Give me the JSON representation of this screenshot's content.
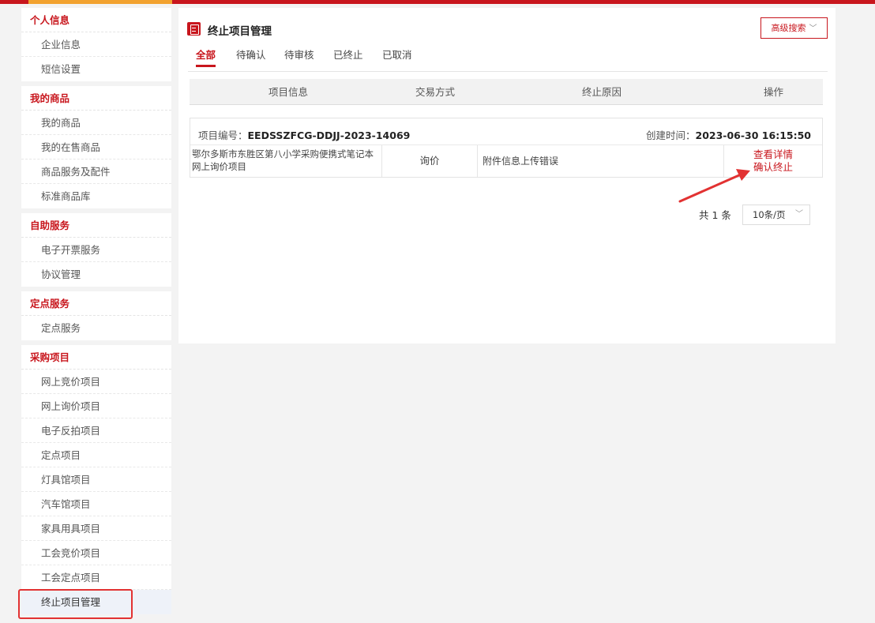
{
  "sidebar": {
    "groups": [
      {
        "title": "个人信息",
        "items": [
          "企业信息",
          "短信设置"
        ]
      },
      {
        "title": "我的商品",
        "items": [
          "我的商品",
          "我的在售商品",
          "商品服务及配件",
          "标准商品库"
        ]
      },
      {
        "title": "自助服务",
        "items": [
          "电子开票服务",
          "协议管理"
        ]
      },
      {
        "title": "定点服务",
        "items": [
          "定点服务"
        ]
      },
      {
        "title": "采购项目",
        "items": [
          "网上竞价项目",
          "网上询价项目",
          "电子反拍项目",
          "定点项目",
          "灯具馆项目",
          "汽车馆项目",
          "家具用具项目",
          "工会竞价项目",
          "工会定点项目",
          "终止项目管理"
        ]
      }
    ],
    "active_item": "终止项目管理"
  },
  "main": {
    "title": "终止项目管理",
    "advanced_search": "高级搜索",
    "tabs": [
      "全部",
      "待确认",
      "待审核",
      "已终止",
      "已取消"
    ],
    "active_tab": "全部",
    "table_headers": [
      "项目信息",
      "交易方式",
      "终止原因",
      "操作"
    ],
    "record": {
      "number_label": "项目编号：",
      "number": "EEDSSZFCG-DDJJ-2023-14069",
      "created_label": "创建时间：",
      "created": "2023-06-30 16:15:50",
      "name_line1": "鄂尔多斯市东胜区第八小学采购便携式笔记本",
      "name_line2": "网上询价项目",
      "trade_mode": "询价",
      "reason": "附件信息上传错误",
      "actions": [
        "查看详情",
        "确认终止"
      ]
    },
    "pagination": {
      "total": "共 1 条",
      "page_size": "10条/页"
    }
  },
  "colors": {
    "brand": "#c8161d",
    "top_accent": "#f2a22f",
    "annotation": "#e23232"
  }
}
